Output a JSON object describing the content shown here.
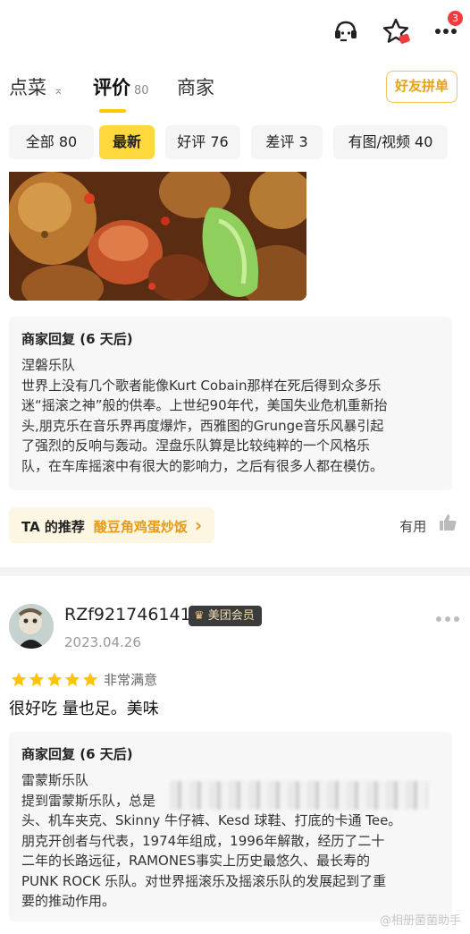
{
  "header": {
    "cart_badge": "3"
  },
  "tabs": {
    "items": [
      {
        "label": "点菜",
        "sub": "⌅"
      },
      {
        "label": "评价",
        "sub": "80"
      },
      {
        "label": "商家",
        "sub": ""
      }
    ],
    "friend_button": "好友拼单"
  },
  "filters": [
    "全部 80",
    "最新",
    "好评 76",
    "差评 3",
    "有图/视频 40"
  ],
  "review1": {
    "reply_header": "商家回复 (6 天后)",
    "reply_lines": [
      "涅磐乐队",
      "世界上没有几个歌者能像Kurt Cobain那样在死后得到众多乐",
      "迷“摇滚之神”般的供奉。上世纪90年代，美国失业危机重新抬",
      "头,朋克乐在音乐界再度爆炸，西雅图的Grunge音乐风暴引起",
      "了强烈的反响与轰动。涅盘乐队算是比较纯粹的一个风格乐",
      "队，在车库摇滚中有很大的影响力，之后有很多人都在模仿。"
    ],
    "rec_label": "TA 的推荐",
    "rec_value": "酸豆角鸡蛋炒饭",
    "rec_arrow": "›",
    "useful_label": "有用"
  },
  "review2": {
    "username": "RZf921746141",
    "member_badge": "美团会员",
    "date": "2023.04.26",
    "rating": 5,
    "rating_text": "非常满意",
    "content": "很好吃 量也足。美味",
    "reply_header": "商家回复 (6 天后)",
    "reply_lines": [
      "雷蒙斯乐队",
      "提到雷蒙斯乐队，总是",
      "头、机车夹克、Skinny 牛仔裤、Kesd 球鞋、打底的卡通 Tee。",
      "朋克开创者与代表，1974年组成，1996年解散，经历了二十",
      "二年的长路远征，RAMONES事实上历史最悠久、最长寿的",
      "PUNK ROCK 乐队。对世界摇滚乐及摇滚乐队的发展起到了重",
      "要的推动作用。"
    ]
  },
  "watermark": "@相册菌菌助手",
  "colors": {
    "accent_yellow": "#ffd93b",
    "accent_orange": "#e79b12",
    "badge_red": "#f03c3c",
    "star_yellow": "#ffc400"
  }
}
